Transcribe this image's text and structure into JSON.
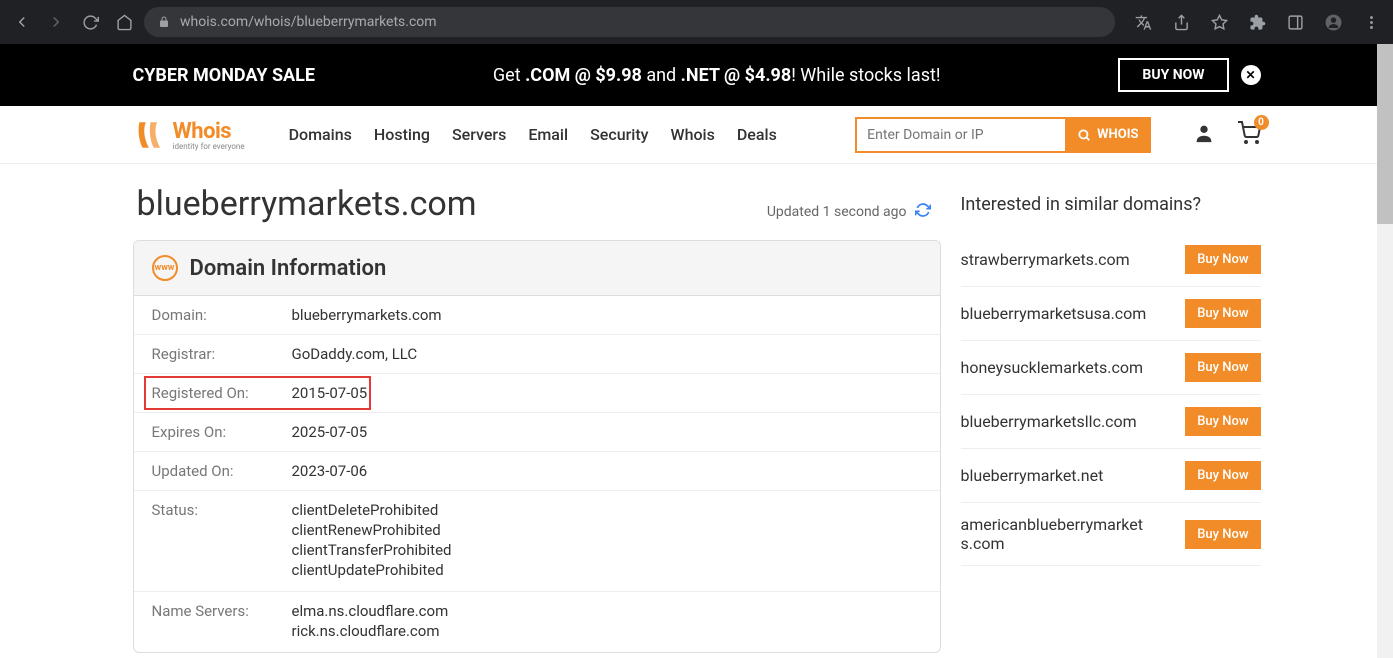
{
  "browser": {
    "url": "whois.com/whois/blueberrymarkets.com"
  },
  "promo": {
    "sale": "CYBER MONDAY SALE",
    "text_prefix": "Get ",
    "com": ".COM @ $9.98",
    "mid": " and ",
    "net": ".NET @ $4.98",
    "suffix": "! While stocks last!",
    "btn": "BUY NOW"
  },
  "logo": {
    "text": "Whois",
    "sub": "identity for everyone"
  },
  "nav": {
    "items": [
      "Domains",
      "Hosting",
      "Servers",
      "Email",
      "Security",
      "Whois",
      "Deals"
    ]
  },
  "search": {
    "placeholder": "Enter Domain or IP",
    "btn": "WHOIS"
  },
  "cart": {
    "count": "0"
  },
  "page": {
    "title": "blueberrymarkets.com",
    "updated": "Updated 1 second ago"
  },
  "panel": {
    "heading": "Domain Information",
    "rows": [
      {
        "label": "Domain:",
        "value": "blueberrymarkets.com"
      },
      {
        "label": "Registrar:",
        "value": "GoDaddy.com, LLC"
      },
      {
        "label": "Registered On:",
        "value": "2015-07-05",
        "highlight": true
      },
      {
        "label": "Expires On:",
        "value": "2025-07-05"
      },
      {
        "label": "Updated On:",
        "value": "2023-07-06"
      },
      {
        "label": "Status:",
        "values": [
          "clientDeleteProhibited",
          "clientRenewProhibited",
          "clientTransferProhibited",
          "clientUpdateProhibited"
        ]
      },
      {
        "label": "Name Servers:",
        "values": [
          "elma.ns.cloudflare.com",
          "rick.ns.cloudflare.com"
        ]
      }
    ]
  },
  "sidebar": {
    "heading": "Interested in similar domains?",
    "buy": "Buy Now",
    "items": [
      "strawberrymarkets.com",
      "blueberrymarketsusa.com",
      "honeysucklemarkets.com",
      "blueberrymarketsllc.com",
      "blueberrymarket.net",
      "americanblueberrymarkets.com"
    ]
  }
}
